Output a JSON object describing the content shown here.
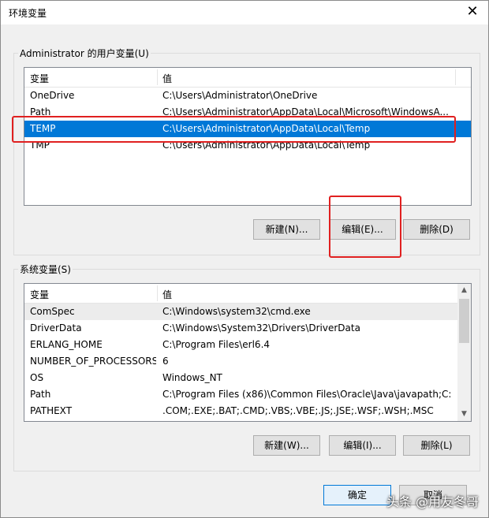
{
  "window": {
    "title": "环境变量",
    "close_glyph": "✕"
  },
  "user_vars": {
    "group_label": "Administrator 的用户变量(U)",
    "header": {
      "name": "变量",
      "value": "值"
    },
    "rows": [
      {
        "name": "OneDrive",
        "value": "C:\\Users\\Administrator\\OneDrive"
      },
      {
        "name": "Path",
        "value": "C:\\Users\\Administrator\\AppData\\Local\\Microsoft\\WindowsA..."
      },
      {
        "name": "TEMP",
        "value": "C:\\Users\\Administrator\\AppData\\Local\\Temp"
      },
      {
        "name": "TMP",
        "value": "C:\\Users\\Administrator\\AppData\\Local\\Temp"
      }
    ],
    "selected_row": "TEMP",
    "buttons": {
      "new": "新建(N)...",
      "edit": "编辑(E)...",
      "delete": "删除(D)"
    }
  },
  "system_vars": {
    "group_label": "系统变量(S)",
    "header": {
      "name": "变量",
      "value": "值"
    },
    "rows": [
      {
        "name": "ComSpec",
        "value": "C:\\Windows\\system32\\cmd.exe"
      },
      {
        "name": "DriverData",
        "value": "C:\\Windows\\System32\\Drivers\\DriverData"
      },
      {
        "name": "ERLANG_HOME",
        "value": "C:\\Program Files\\erl6.4"
      },
      {
        "name": "NUMBER_OF_PROCESSORS",
        "value": "6"
      },
      {
        "name": "OS",
        "value": "Windows_NT"
      },
      {
        "name": "Path",
        "value": "C:\\Program Files (x86)\\Common Files\\Oracle\\Java\\javapath;C:..."
      },
      {
        "name": "PATHEXT",
        "value": ".COM;.EXE;.BAT;.CMD;.VBS;.VBE;.JS;.JSE;.WSF;.WSH;.MSC"
      }
    ],
    "highlighted_row": "ComSpec",
    "buttons": {
      "new": "新建(W)...",
      "edit": "编辑(I)...",
      "delete": "删除(L)"
    },
    "scroll_up": "▲",
    "scroll_down": "▼"
  },
  "dialog_buttons": {
    "ok": "确定",
    "cancel": "取消"
  },
  "watermark": "头条 @用友冬哥",
  "colors": {
    "selection": "#0078d7",
    "annotation": "#e02020"
  }
}
